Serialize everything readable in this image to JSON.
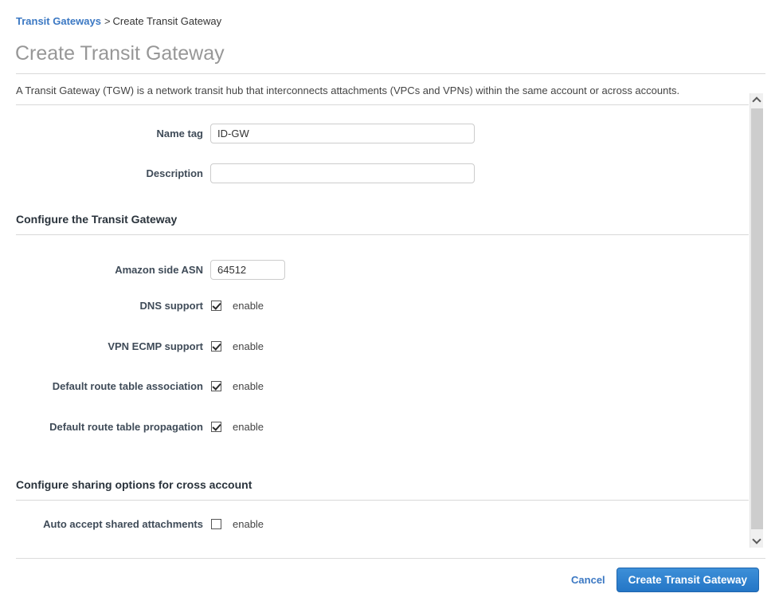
{
  "breadcrumb": {
    "link": "Transit Gateways",
    "separator": ">",
    "current": "Create Transit Gateway"
  },
  "page": {
    "title": "Create Transit Gateway",
    "intro": "A Transit Gateway (TGW) is a network transit hub that interconnects attachments (VPCs and VPNs) within the same account or across accounts."
  },
  "form": {
    "name_tag": {
      "label": "Name tag",
      "value": "ID-GW",
      "placeholder": ""
    },
    "description": {
      "label": "Description",
      "value": "",
      "placeholder": ""
    }
  },
  "section_configure": {
    "title": "Configure the Transit Gateway",
    "asn": {
      "label": "Amazon side ASN",
      "value": "64512",
      "placeholder": ""
    },
    "checkboxes": [
      {
        "label": "DNS support",
        "enable_label": "enable",
        "checked": true
      },
      {
        "label": "VPN ECMP support",
        "enable_label": "enable",
        "checked": true
      },
      {
        "label": "Default route table association",
        "enable_label": "enable",
        "checked": true
      },
      {
        "label": "Default route table propagation",
        "enable_label": "enable",
        "checked": true
      }
    ]
  },
  "section_sharing": {
    "title": "Configure sharing options for cross account",
    "checkboxes": [
      {
        "label": "Auto accept shared attachments",
        "enable_label": "enable",
        "checked": false
      }
    ]
  },
  "footer": {
    "cancel_label": "Cancel",
    "create_label": "Create Transit Gateway"
  },
  "scrollbar": {
    "up_icon": "chevron-up-icon",
    "down_icon": "chevron-down-icon"
  },
  "colors": {
    "link": "#3b78c3",
    "primary_button": "#2476c6",
    "title": "#979797",
    "label": "#3f4b58"
  }
}
